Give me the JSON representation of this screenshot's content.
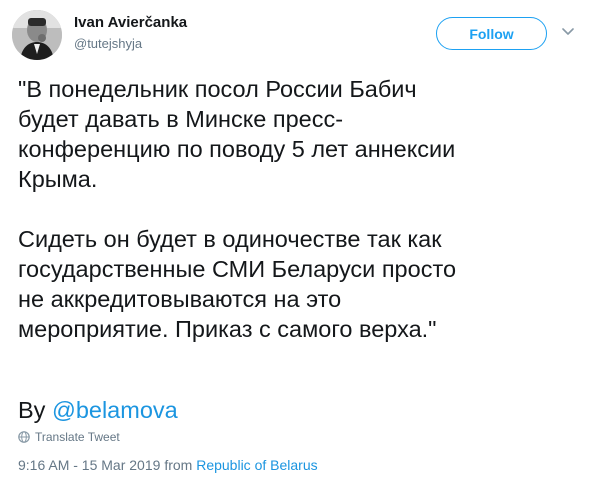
{
  "author": {
    "name": "Ivan Avierčanka",
    "handle": "@tutejshyja"
  },
  "header": {
    "follow_label": "Follow"
  },
  "tweet": {
    "paragraph1": [
      "\"В понедельник посол России Бабич",
      "будет давать в Минске пресс-",
      "конференцию по поводу 5 лет аннексии",
      "Крыма."
    ],
    "paragraph2": [
      "Сидеть он будет в одиночестве так как",
      "государственные СМИ Беларуси просто",
      "не аккредитовываются на это",
      "мероприятие. Приказ с самого верха.\""
    ],
    "byline_prefix": "By",
    "mention": "@belamova"
  },
  "translate": {
    "label": "Translate Tweet"
  },
  "meta": {
    "timestamp": "9:16 AM - 15 Mar 2019",
    "from_word": "from",
    "place": "Republic of Belarus"
  },
  "colors": {
    "accent": "#1da1f2",
    "link": "#1b95e0",
    "muted": "#657786",
    "text": "#14171a"
  },
  "icons": {
    "menu": "chevron-down-icon",
    "translate": "globe-icon"
  }
}
